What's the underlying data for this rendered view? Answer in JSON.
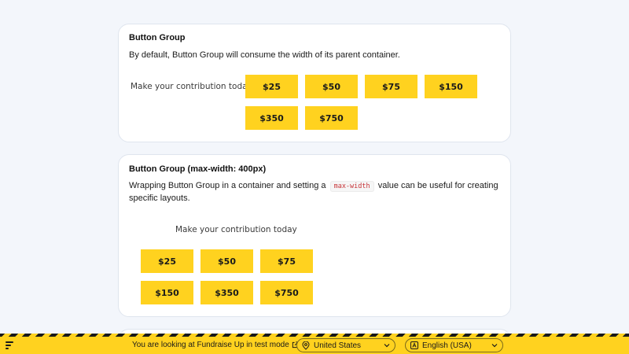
{
  "card1": {
    "title": "Button Group",
    "description": "By default, Button Group will consume the width of its parent container.",
    "contribution_label": "Make your contribution today",
    "amounts": [
      "$25",
      "$50",
      "$75",
      "$150",
      "$350",
      "$750"
    ]
  },
  "card2": {
    "title": "Button Group (max-width: 400px)",
    "description_before": "Wrapping Button Group in a container and setting a",
    "code": "max-width",
    "description_after": "value can be useful for creating specific layouts.",
    "contribution_label": "Make your contribution today",
    "amounts": [
      "$25",
      "$50",
      "$75",
      "$150",
      "$350",
      "$750"
    ]
  },
  "banner": {
    "message": "You are looking at Fundraise Up in test mode",
    "country": "United States",
    "language": "English (USA)",
    "icons": [
      "fundraise-up-logo-icon",
      "external-link-icon",
      "location-pin-icon",
      "chevron-down-icon",
      "language-icon"
    ]
  },
  "colors": {
    "accent": "#ffd21f",
    "background": "#f3f6fb",
    "code_text": "#c7363a"
  }
}
